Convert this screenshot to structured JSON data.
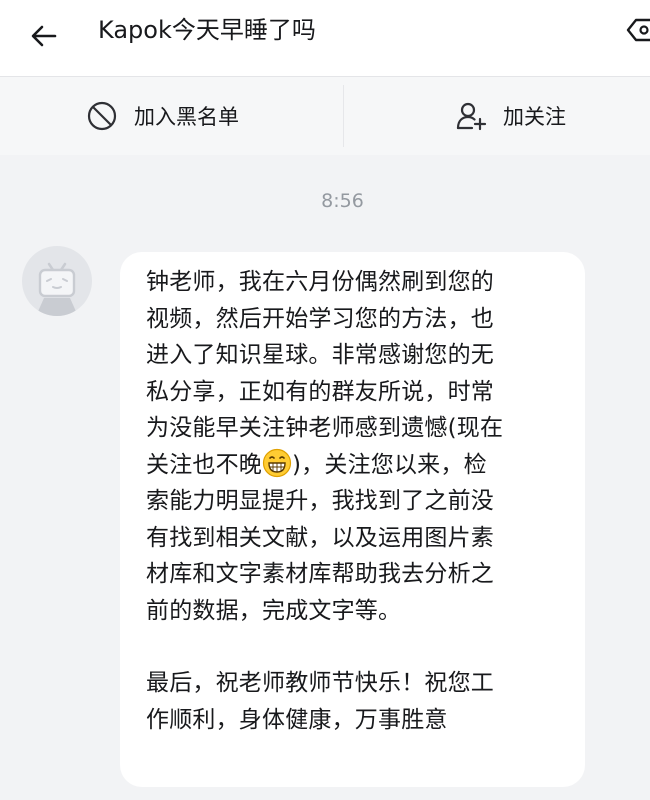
{
  "header": {
    "title": "Kapok今天早睡了吗",
    "back_icon": "arrow-left-icon",
    "more_icon": "settings-icon"
  },
  "actions": {
    "block_label": "加入黑名单",
    "block_icon": "block-icon",
    "follow_label": "加关注",
    "follow_icon": "add-user-icon"
  },
  "chat": {
    "timestamp": "8:56",
    "message": {
      "sender_avatar": "tv-mascot-avatar",
      "lines_part1": "钟老师，我在六月份偶然刷到您的\n视频，然后开始学习您的方法，也\n进入了知识星球。非常感谢您的无\n私分享，正如有的群友所说，时常\n为没能早关注钟老师感到遗憾(现在\n关注也不晚",
      "emoji": "grinning-face-emoji",
      "lines_part2": ")，关注您以来，检\n索能力明显提升，我找到了之前没\n有找到相关文献，以及运用图片素\n材库和文字素材库帮助我去分析之\n前的数据，完成文字等。",
      "lines_part3": "最后，祝老师教师节快乐！祝您工\n作顺利，身体健康，万事胜意"
    }
  },
  "colors": {
    "background": "#f2f3f5",
    "header_bg": "#ffffff",
    "bubble_bg": "#ffffff",
    "text": "#18191c",
    "muted": "#9499a0"
  }
}
